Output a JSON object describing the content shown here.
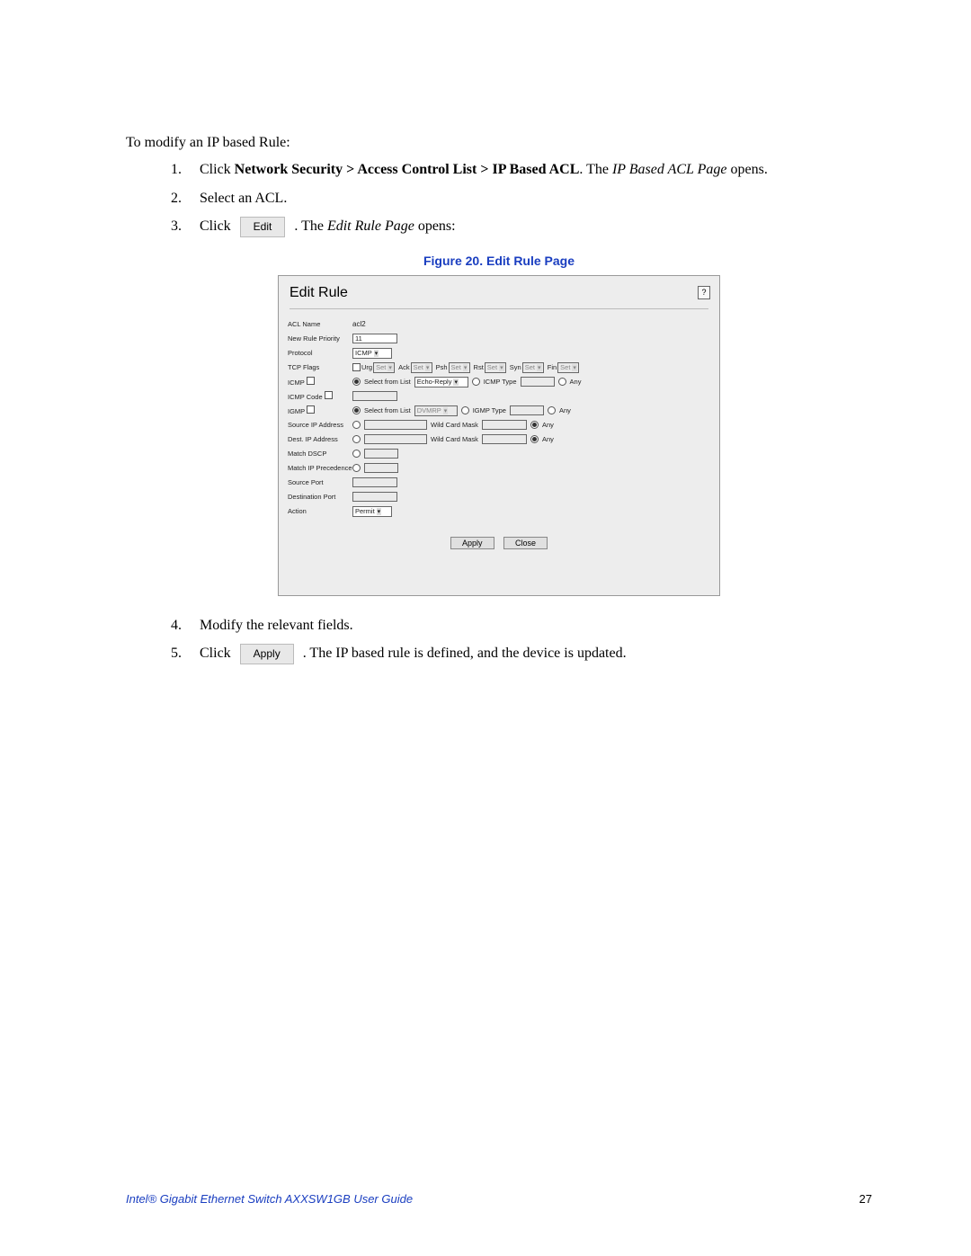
{
  "intro": "To modify an IP based Rule:",
  "steps": {
    "s1": {
      "num": "1.",
      "pre": "Click ",
      "bold": "Network Security > Access Control List > IP Based ACL",
      "mid": ". The ",
      "italic": "IP Based ACL Page",
      "post": " opens."
    },
    "s2": {
      "num": "2.",
      "text": "Select an ACL."
    },
    "s3": {
      "num": "3.",
      "pre": "Click ",
      "btn": "Edit",
      "mid": " . The ",
      "italic": "Edit Rule Page",
      "post": " opens:"
    },
    "s4": {
      "num": "4.",
      "text": "Modify the relevant fields."
    },
    "s5": {
      "num": "5.",
      "pre": "Click ",
      "btn": "Apply",
      "post": " . The IP based rule is defined, and the device is updated."
    }
  },
  "figure_caption": "Figure 20. Edit Rule Page",
  "panel": {
    "title": "Edit Rule",
    "help": "?",
    "labels": {
      "acl_name": "ACL Name",
      "priority": "New Rule Priority",
      "protocol": "Protocol",
      "tcp_flags": "TCP Flags",
      "icmp1": "ICMP",
      "icmp_code": "ICMP Code",
      "igmp": "IGMP",
      "src_ip": "Source IP Address",
      "dst_ip": "Dest. IP Address",
      "dscp": "Match DSCP",
      "ip_prec": "Match IP Precedence",
      "src_port": "Source Port",
      "dst_port": "Destination Port",
      "action": "Action"
    },
    "values": {
      "acl_name": "acl2",
      "priority": "11",
      "protocol": "ICMP",
      "icmp_list": "Echo-Reply",
      "igmp_list": "DVMRP",
      "action": "Permit",
      "tcp_set": "Set",
      "urg": "Urg",
      "ack": "Ack",
      "psh": "Psh",
      "rst": "Rst",
      "syn": "Syn",
      "fin": "Fin",
      "select_from_list": "Select from List",
      "icmp_type": "ICMP Type",
      "igmp_type": "IGMP Type",
      "any": "Any",
      "wild": "Wild Card Mask"
    },
    "buttons": {
      "apply": "Apply",
      "close": "Close"
    }
  },
  "footer": {
    "title": "Intel® Gigabit Ethernet Switch AXXSW1GB User Guide",
    "page": "27"
  }
}
